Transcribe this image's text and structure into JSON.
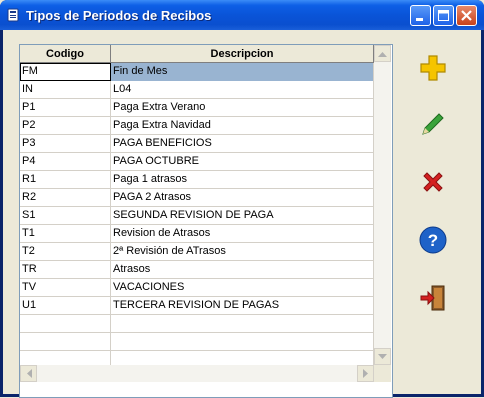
{
  "window": {
    "title": "Tipos de Periodos de Recibos"
  },
  "table": {
    "columns": [
      "Codigo",
      "Descripcion"
    ],
    "rows": [
      {
        "code": "FM",
        "description": "Fin de Mes",
        "selected": true
      },
      {
        "code": "IN",
        "description": "L04"
      },
      {
        "code": "P1",
        "description": "Paga Extra Verano"
      },
      {
        "code": "P2",
        "description": "Paga Extra Navidad"
      },
      {
        "code": "P3",
        "description": "PAGA BENEFICIOS"
      },
      {
        "code": "P4",
        "description": "PAGA OCTUBRE"
      },
      {
        "code": "R1",
        "description": "Paga 1 atrasos"
      },
      {
        "code": "R2",
        "description": "PAGA 2 Atrasos"
      },
      {
        "code": "S1",
        "description": "SEGUNDA REVISION DE PAGA"
      },
      {
        "code": "T1",
        "description": "Revision de Atrasos"
      },
      {
        "code": "T2",
        "description": "2ª Revisión de ATrasos"
      },
      {
        "code": "TR",
        "description": "Atrasos"
      },
      {
        "code": "TV",
        "description": "VACACIONES"
      },
      {
        "code": "U1",
        "description": "TERCERA REVISION DE PAGAS"
      }
    ]
  },
  "actions": [
    {
      "name": "add-button",
      "icon": "plus-icon",
      "color": "#f5c400"
    },
    {
      "name": "edit-button",
      "icon": "pencil-icon",
      "color": "#3aa33a"
    },
    {
      "name": "delete-button",
      "icon": "x-icon",
      "color": "#d42020"
    },
    {
      "name": "help-button",
      "icon": "help-icon",
      "color": "#1e62c8"
    },
    {
      "name": "exit-button",
      "icon": "exit-door-icon",
      "color": "#c84a1a"
    }
  ]
}
